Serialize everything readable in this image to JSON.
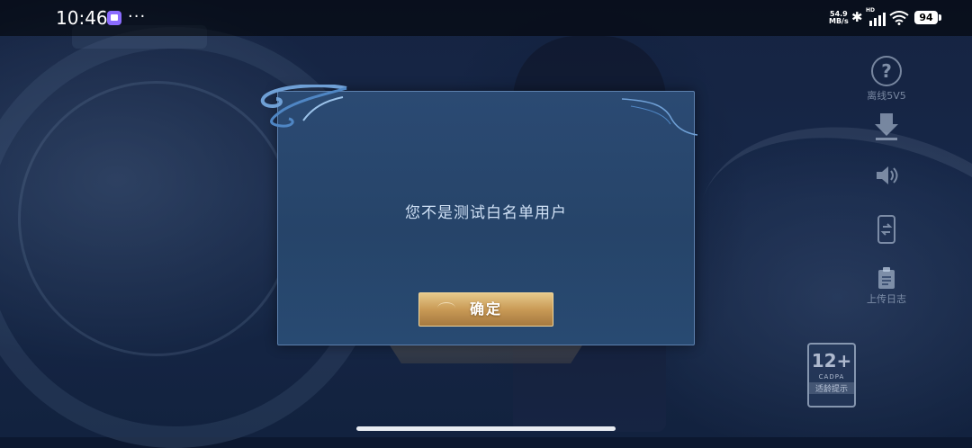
{
  "status_bar": {
    "time": "10:46",
    "more_indicator": "···",
    "net_speed_value": "54.9",
    "net_speed_unit": "MB/s",
    "hd_label": "HD",
    "battery_level": "94",
    "icons": [
      "app-notification-icon",
      "bluetooth-icon",
      "signal-icon",
      "wifi-icon",
      "battery-icon"
    ]
  },
  "side_menu": {
    "help_label": "离线5V5",
    "upload_log_label": "上传日志",
    "icons": [
      "help-icon",
      "download-icon",
      "sound-icon",
      "phone-switch-icon",
      "clipboard-icon"
    ]
  },
  "age_badge": {
    "age": "12+",
    "org": "CADPA",
    "tip": "适龄提示"
  },
  "dialog": {
    "message": "您不是测试白名单用户",
    "confirm_label": "确定"
  },
  "colors": {
    "dialog_bg": "#264469",
    "dialog_border": "#5d80ad",
    "button_gold": "#c99a56",
    "text_light": "#cfe0f5"
  }
}
